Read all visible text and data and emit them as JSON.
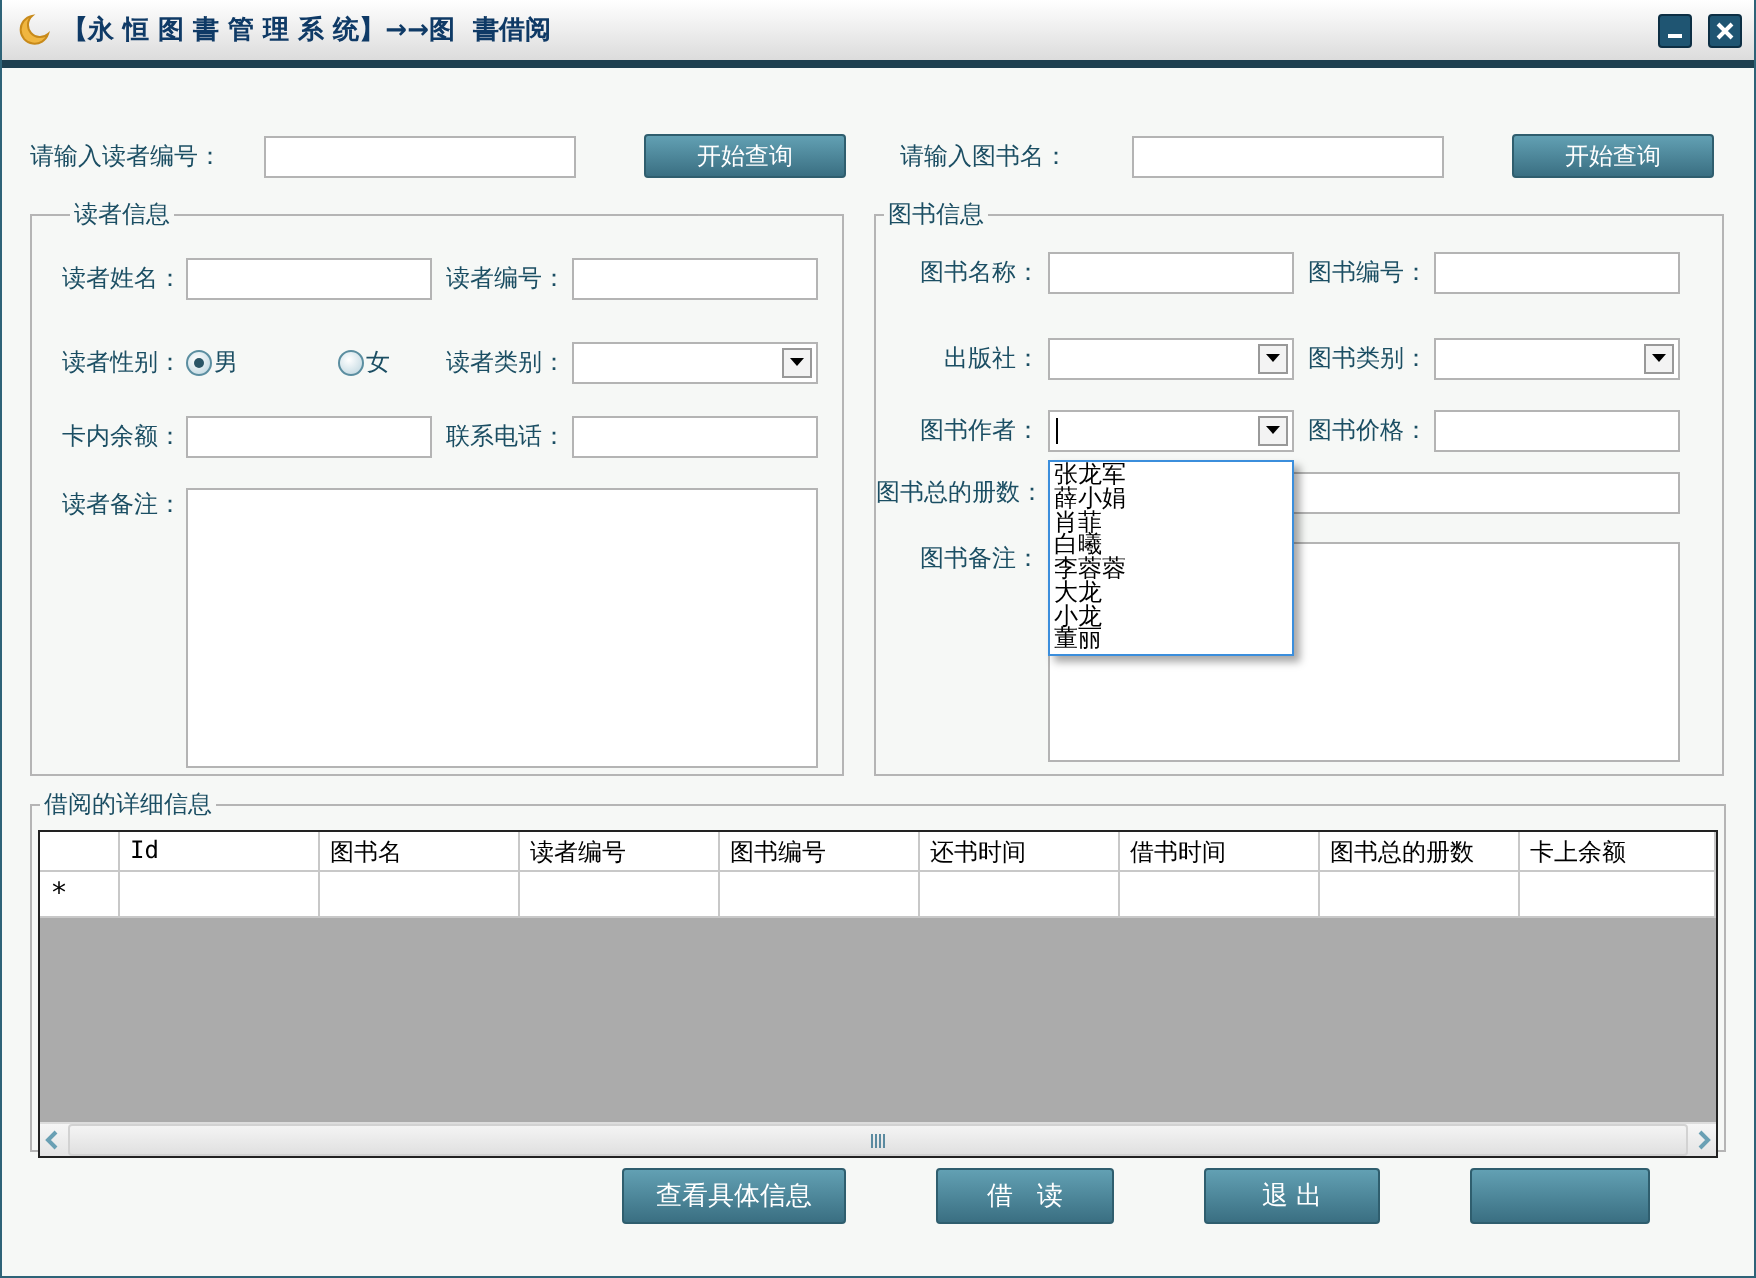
{
  "window": {
    "title": "【永 恒 图 書 管 理 系 统】→→图  書借阅"
  },
  "reader_query": {
    "label": "请输入读者编号：",
    "button": "开始查询"
  },
  "book_query": {
    "label": "请输入图书名：",
    "button": "开始查询"
  },
  "reader_info": {
    "title": "读者信息",
    "name_label": "读者姓名：",
    "id_label": "读者编号：",
    "gender_label": "读者性别：",
    "gender_options": [
      {
        "label": "男",
        "selected": true
      },
      {
        "label": "女",
        "selected": false
      }
    ],
    "type_label": "读者类别：",
    "balance_label": "卡内余额：",
    "phone_label": "联系电话：",
    "note_label": "读者备注："
  },
  "book_info": {
    "title": "图书信息",
    "name_label": "图书名称：",
    "id_label": "图书编号：",
    "publisher_label": "出版社：",
    "type_label": "图书类别：",
    "author_label": "图书作者：",
    "author_focused": true,
    "author_dropdown_open": true,
    "author_options": [
      "张龙军",
      "薛小娟",
      "肖菲",
      "白曦",
      "李蓉蓉",
      "大龙",
      "小龙",
      "董丽"
    ],
    "price_label": "图书价格：",
    "total_label": "图书总的册数：",
    "note_label": "图书备注："
  },
  "borrow_details": {
    "title": "借阅的详细信息",
    "columns": [
      "Id",
      "图书名",
      "读者编号",
      "图书编号",
      "还书时间",
      "借书时间",
      "图书总的册数",
      "卡上余额"
    ],
    "new_row_marker": "*"
  },
  "buttons": [
    {
      "kind": "labeled",
      "label": "查看具体信息"
    },
    {
      "kind": "labeled",
      "label": "借   读"
    },
    {
      "kind": "labeled",
      "label": "退 出"
    },
    {
      "kind": "covered"
    }
  ]
}
